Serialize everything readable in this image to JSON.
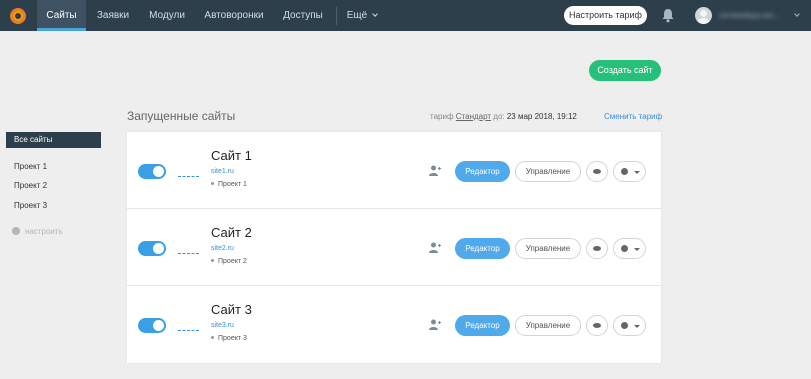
{
  "topnav": {
    "items": [
      {
        "label": "Сайты",
        "active": true
      },
      {
        "label": "Заявки",
        "active": false
      },
      {
        "label": "Модули",
        "active": false
      },
      {
        "label": "Автоворонки",
        "active": false
      },
      {
        "label": "Доступы",
        "active": false
      },
      {
        "label": "Ещё",
        "active": false
      }
    ],
    "tariff_button": "Настроить тариф",
    "icons": {
      "logo": "logo-icon",
      "bell": "bell-icon",
      "avatar": "avatar-icon"
    },
    "user_name": "mrnewdaya.em..."
  },
  "create_button": "Создать сайт",
  "sidebar": {
    "all_sites": "Все сайты",
    "projects": [
      "Проект 1",
      "Проект 2",
      "Проект 3"
    ],
    "settings": "настроить"
  },
  "heading": "Запущенные сайты",
  "tariff": {
    "prefix": "тариф",
    "plan": "Стандарт",
    "until": "до:",
    "date": "23 мар 2018, 19:12",
    "change_link": "Сменить тариф"
  },
  "sites": [
    {
      "name": "Сайт 1",
      "url": "site1.ru",
      "project": "Проект 1",
      "enabled": true
    },
    {
      "name": "Сайт 2",
      "url": "site2.ru",
      "project": "Проект 2",
      "enabled": true
    },
    {
      "name": "Сайт 3",
      "url": "site3.ru",
      "project": "Проект 3",
      "enabled": true
    }
  ],
  "actions": {
    "editor": "Редактор",
    "manage": "Управление"
  },
  "colors": {
    "topbar": "#2d3f4b",
    "accent_blue": "#4fa9ea",
    "create_green": "#27c07a"
  }
}
